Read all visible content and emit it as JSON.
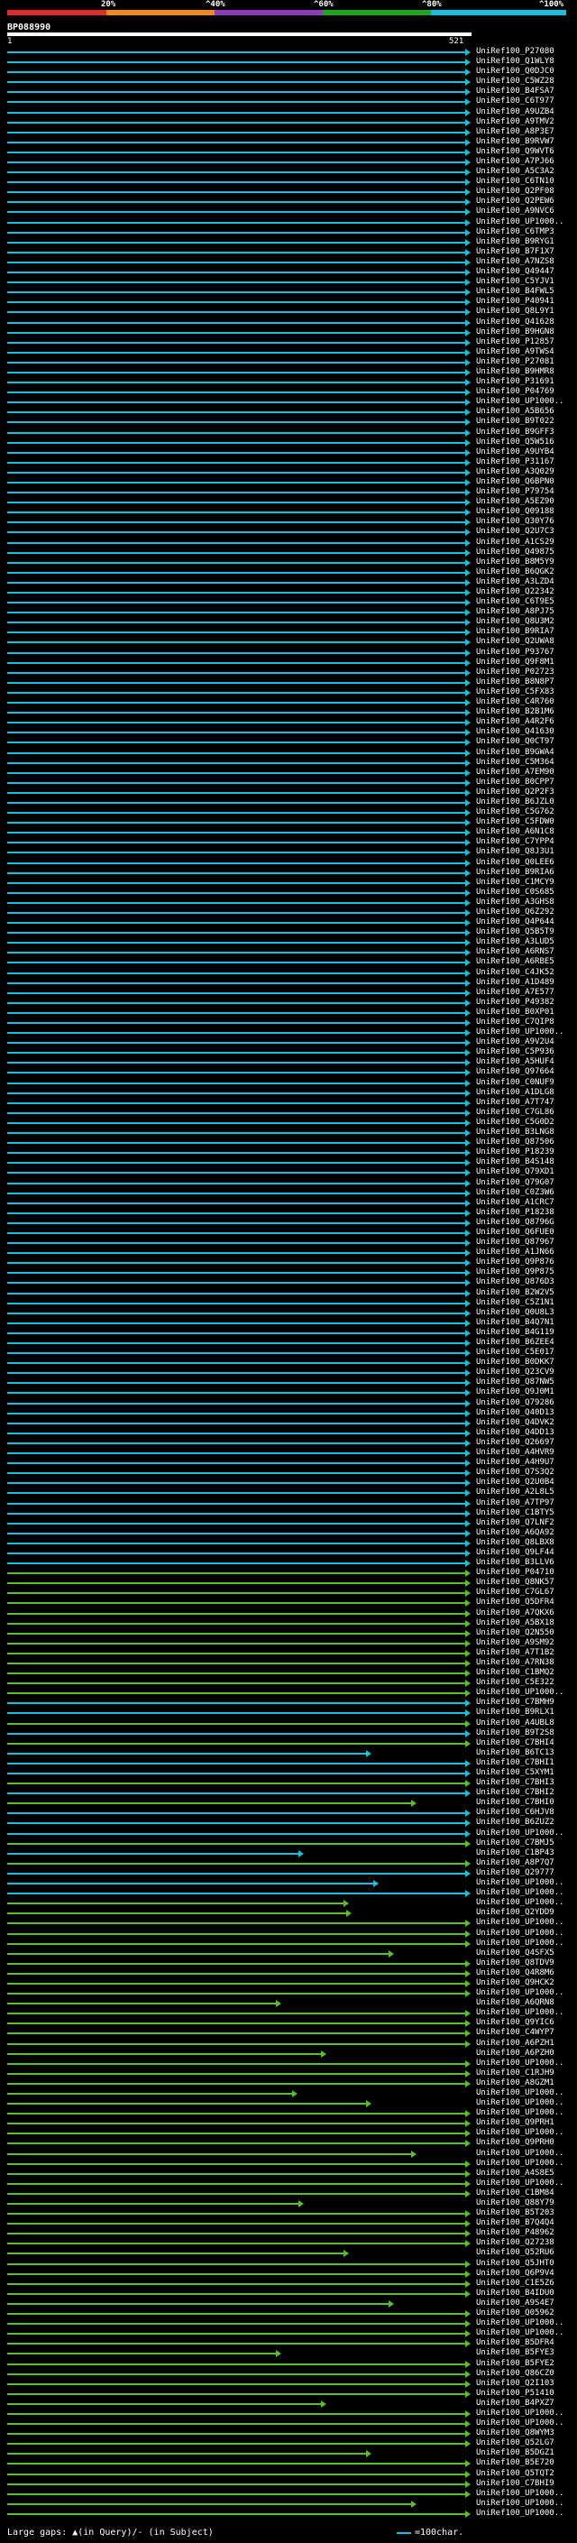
{
  "scale": {
    "labels": [
      "20%",
      "^40%",
      "^60%",
      "^80%",
      "^100%"
    ],
    "colors": [
      "#e02b2b",
      "#f08a1c",
      "#8a3fb8",
      "#1fa51f",
      "#19bfdd"
    ]
  },
  "query": {
    "id": "BP088990",
    "start": "1",
    "end": "521"
  },
  "colors": {
    "cyan": "#19bfdd",
    "green": "#5bbe2e",
    "white": "#ffffff"
  },
  "hits": [
    "UniRef100_P27080",
    "UniRef100_Q1WLY8",
    "UniRef100_Q0DJC0",
    "UniRef100_C5WZ28",
    "UniRef100_B4FSA7",
    "UniRef100_C6T977",
    "UniRef100_A9UZB4",
    "UniRef100_A9TMV2",
    "UniRef100_A8P3E7",
    "UniRef100_B9RVW7",
    "UniRef100_Q9WVT6",
    "UniRef100_A7PJ66",
    "UniRef100_A5C3A2",
    "UniRef100_C6TN10",
    "UniRef100_Q2PF08",
    "UniRef100_Q2PEW6",
    "UniRef100_A9NVC6",
    "UniRef100_UP1000..",
    "UniRef100_C6TMP3",
    "UniRef100_B9RYG1",
    "UniRef100_B7F1X7",
    "UniRef100_A7NZS8",
    "UniRef100_Q49447",
    "UniRef100_C5YJV1",
    "UniRef100_B4FWL5",
    "UniRef100_P40941",
    "UniRef100_Q8L9Y1",
    "UniRef100_Q41628",
    "UniRef100_B9HGN8",
    "UniRef100_P12857",
    "UniRef100_A9TWS4",
    "UniRef100_P27081",
    "UniRef100_B9HMR8",
    "UniRef100_P31691",
    "UniRef100_P04769",
    "UniRef100_UP1000..",
    "UniRef100_A5B656",
    "UniRef100_B9T022",
    "UniRef100_B9GFF3",
    "UniRef100_Q5W516",
    "UniRef100_A9UYB4",
    "UniRef100_P31167",
    "UniRef100_A3Q029",
    "UniRef100_Q6BPN0",
    "UniRef100_P79754",
    "UniRef100_A5EZ90",
    "UniRef100_Q09188",
    "UniRef100_Q30Y76",
    "UniRef100_Q2U7C3",
    "UniRef100_A1CS29",
    "UniRef100_Q49875",
    "UniRef100_B8M5Y9",
    "UniRef100_B6QGK2",
    "UniRef100_A3LZD4",
    "UniRef100_Q22342",
    "UniRef100_C6T9E5",
    "UniRef100_A8PJ75",
    "UniRef100_Q8U3M2",
    "UniRef100_B9RIA7",
    "UniRef100_Q2UWA8",
    "UniRef100_P93767",
    "UniRef100_Q9F8M1",
    "UniRef100_P02723",
    "UniRef100_B8N8P7",
    "UniRef100_C5FX83",
    "UniRef100_C4R760",
    "UniRef100_B2B1M6",
    "UniRef100_A4R2F6",
    "UniRef100_Q41630",
    "UniRef100_Q0CT97",
    "UniRef100_B9GWA4",
    "UniRef100_C5M364",
    "UniRef100_A7EM90",
    "UniRef100_B0CPP7",
    "UniRef100_Q2P2F3",
    "UniRef100_B6JZL0",
    "UniRef100_C5G762",
    "UniRef100_C5FDW0",
    "UniRef100_A6N1C8",
    "UniRef100_C7YPP4",
    "UniRef100_Q8J3U1",
    "UniRef100_Q0LEE6",
    "UniRef100_B9RIA6",
    "UniRef100_C1MCY9",
    "UniRef100_C0S685",
    "UniRef100_A3GHS8",
    "UniRef100_Q6Z292",
    "UniRef100_Q4P644",
    "UniRef100_Q5B5T9",
    "UniRef100_A3LUD5",
    "UniRef100_A6RNS7",
    "UniRef100_A6RBE5",
    "UniRef100_C4JK52",
    "UniRef100_A1D489",
    "UniRef100_A7E577",
    "UniRef100_P49382",
    "UniRef100_B0XP01",
    "UniRef100_C7QIP8",
    "UniRef100_UP1000..",
    "UniRef100_A9V2U4",
    "UniRef100_C5P936",
    "UniRef100_A5HUF4",
    "UniRef100_Q97664",
    "UniRef100_C0NUF9",
    "UniRef100_A1DLG8",
    "UniRef100_A7T747",
    "UniRef100_C7GL86",
    "UniRef100_C5G0D2",
    "UniRef100_B3LNG8",
    "UniRef100_Q87506",
    "UniRef100_P18239",
    "UniRef100_B4S148",
    "UniRef100_Q79XD1",
    "UniRef100_Q79G07",
    "UniRef100_C0Z3W6",
    "UniRef100_A1CRC7",
    "UniRef100_P18238",
    "UniRef100_Q8796G",
    "UniRef100_Q6FUE0",
    "UniRef100_Q87967",
    "UniRef100_A1JN66",
    "UniRef100_Q9P876",
    "UniRef100_Q9P875",
    "UniRef100_Q876D3",
    "UniRef100_B2W2V5",
    "UniRef100_C5Z1N1",
    "UniRef100_Q0U8L3",
    "UniRef100_B4Q7N1",
    "UniRef100_B4G119",
    "UniRef100_B6ZEE4",
    "UniRef100_C5E017",
    "UniRef100_B0DKK7",
    "UniRef100_Q23CV9",
    "UniRef100_Q87NW5",
    "UniRef100_Q9J0M1",
    "UniRef100_Q79286",
    "UniRef100_Q40D13",
    "UniRef100_Q4DVK2",
    "UniRef100_Q4DD13",
    "UniRef100_Q26697",
    "UniRef100_A4HVR9",
    "UniRef100_A4H9U7",
    "UniRef100_Q7S3Q2",
    "UniRef100_Q2U0B4",
    "UniRef100_A2L8L5",
    "UniRef100_A7TP97",
    "UniRef100_C1BTY5",
    "UniRef100_Q7LNF2",
    "UniRef100_A6QA92",
    "UniRef100_Q8LBX8",
    "UniRef100_Q9LF44",
    "UniRef100_B3LLV6",
    "UniRef100_P04710",
    "UniRef100_Q8NK57",
    "UniRef100_C7GL67",
    "UniRef100_Q5DFR4",
    "UniRef100_A7QKX6",
    "UniRef100_A5BX18",
    "UniRef100_Q2N550",
    "UniRef100_A9SM92",
    "UniRef100_A7T1B2",
    "UniRef100_A7RN38",
    "UniRef100_C1BMQ2",
    "UniRef100_C5E322",
    "UniRef100_UP1000..",
    "UniRef100_C7BMH9",
    "UniRef100_B9RLX1",
    "UniRef100_A4UBL8",
    "UniRef100_B9T2S8",
    "UniRef100_C7BHI4",
    "UniRef100_B6TC13",
    "UniRef100_C7BHI1",
    "UniRef100_C5XYM1",
    "UniRef100_C7BHI3",
    "UniRef100_C7BHI2",
    "UniRef100_C7BHI0",
    "UniRef100_C6HJV8",
    "UniRef100_B6ZUZ2",
    "UniRef100_UP1000..",
    "UniRef100_C7BMJ5",
    "UniRef100_C1BP43",
    "UniRef100_A8P7Q7",
    "UniRef100_Q29777",
    "UniRef100_UP1000..",
    "UniRef100_UP1000..",
    "UniRef100_UP1000..",
    "UniRef100_Q2YDD9",
    "UniRef100_UP1000..",
    "UniRef100_UP1000..",
    "UniRef100_UP1000..",
    "UniRef100_Q4SFX5",
    "UniRef100_Q8TDV9",
    "UniRef100_Q4R8M6",
    "UniRef100_Q9HCK2",
    "UniRef100_UP1000..",
    "UniRef100_A6QRN8",
    "UniRef100_UP1000..",
    "UniRef100_Q9YIC6",
    "UniRef100_C4WYP7",
    "UniRef100_A6PZH1",
    "UniRef100_A6PZH0",
    "UniRef100_UP1000..",
    "UniRef100_C1RJH9",
    "UniRef100_A8GZM1",
    "UniRef100_UP1000..",
    "UniRef100_UP1000..",
    "UniRef100_UP1000..",
    "UniRef100_Q9PRH1",
    "UniRef100_UP1000..",
    "UniRef100_Q9PRH0",
    "UniRef100_UP1000..",
    "UniRef100_UP1000..",
    "UniRef100_A4S8E5",
    "UniRef100_UP1000..",
    "UniRef100_C1BM84",
    "UniRef100_Q88Y79",
    "UniRef100_B5T203",
    "UniRef100_B7Q4Q4",
    "UniRef100_P48962",
    "UniRef100_Q27238",
    "UniRef100_Q52RU6",
    "UniRef100_Q5JHT0",
    "UniRef100_Q6P9V4",
    "UniRef100_C1E5Z6",
    "UniRef100_B4IDU0",
    "UniRef100_A9S4E7",
    "UniRef100_Q05962",
    "UniRef100_UP1000..",
    "UniRef100_UP1000..",
    "UniRef100_B5DFR4",
    "UniRef100_B5FYE3",
    "UniRef100_B5FYE2",
    "UniRef100_Q86CZ0",
    "UniRef100_Q2I103",
    "UniRef100_P51410",
    "UniRef100_B4PXZ7",
    "UniRef100_UP1000..",
    "UniRef100_UP1000..",
    "UniRef100_Q8WYM3",
    "UniRef100_Q52LG7",
    "UniRef100_B5DGZ1",
    "UniRef100_B5E720",
    "UniRef100_Q5TQT2",
    "UniRef100_C7BHI9",
    "UniRef100_UP1000..",
    "UniRef100_UP1000..",
    "UniRef100_UP1000.."
  ],
  "legend": {
    "left": "Large gaps: ▲(in Query)/- (in Subject)",
    "right": "=100char."
  }
}
